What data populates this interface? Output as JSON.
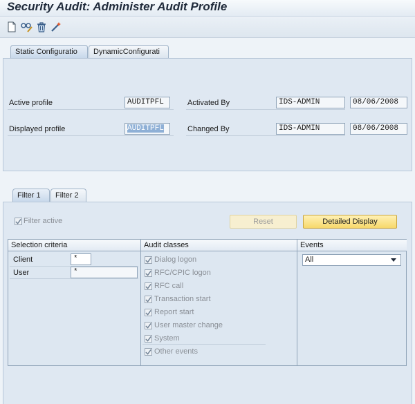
{
  "title": "Security Audit: Administer Audit Profile",
  "toolbar": {
    "icons": [
      "new-document-icon",
      "glasses-edit-icon",
      "trash-icon",
      "magic-wand-icon"
    ]
  },
  "top_tabs": [
    {
      "label": "Static Configuratio",
      "active": true
    },
    {
      "label": "DynamicConfigurati",
      "active": false
    }
  ],
  "profile": {
    "active_profile_label": "Active profile",
    "active_profile_value": "AUDITPFL",
    "activated_by_label": "Activated By",
    "activated_by_value": "IDS-ADMIN",
    "activated_date": "08/06/2008",
    "displayed_profile_label": "Displayed profile",
    "displayed_profile_value": "AUDITPFL",
    "changed_by_label": "Changed By",
    "changed_by_value": "IDS-ADMIN",
    "changed_date": "08/06/2008"
  },
  "filter_tabs": [
    {
      "label": "Filter 1",
      "active": true
    },
    {
      "label": "Filter 2",
      "active": false
    }
  ],
  "filter": {
    "filter_active_label": "Filter active",
    "filter_active_checked": true,
    "reset_label": "Reset",
    "detailed_display_label": "Detailed Display"
  },
  "grid": {
    "headers": {
      "selection": "Selection criteria",
      "audit_classes": "Audit classes",
      "events": "Events"
    },
    "criteria": [
      {
        "label": "Client",
        "value": "*"
      },
      {
        "label": "User",
        "value": "*"
      }
    ],
    "audit_classes": [
      {
        "label": "Dialog logon",
        "checked": true
      },
      {
        "label": "RFC/CPIC logon",
        "checked": true
      },
      {
        "label": "RFC call",
        "checked": true
      },
      {
        "label": "Transaction start",
        "checked": true
      },
      {
        "label": "Report start",
        "checked": true
      },
      {
        "label": "User master change",
        "checked": true
      },
      {
        "label": "System",
        "checked": true
      },
      {
        "label": "Other events",
        "checked": true
      }
    ],
    "events_value": "All"
  },
  "colors": {
    "background": "#eef3f8",
    "panel": "#dfe8f2",
    "primary_button": "#f7d86b",
    "checkmark": "#6d7f93"
  }
}
